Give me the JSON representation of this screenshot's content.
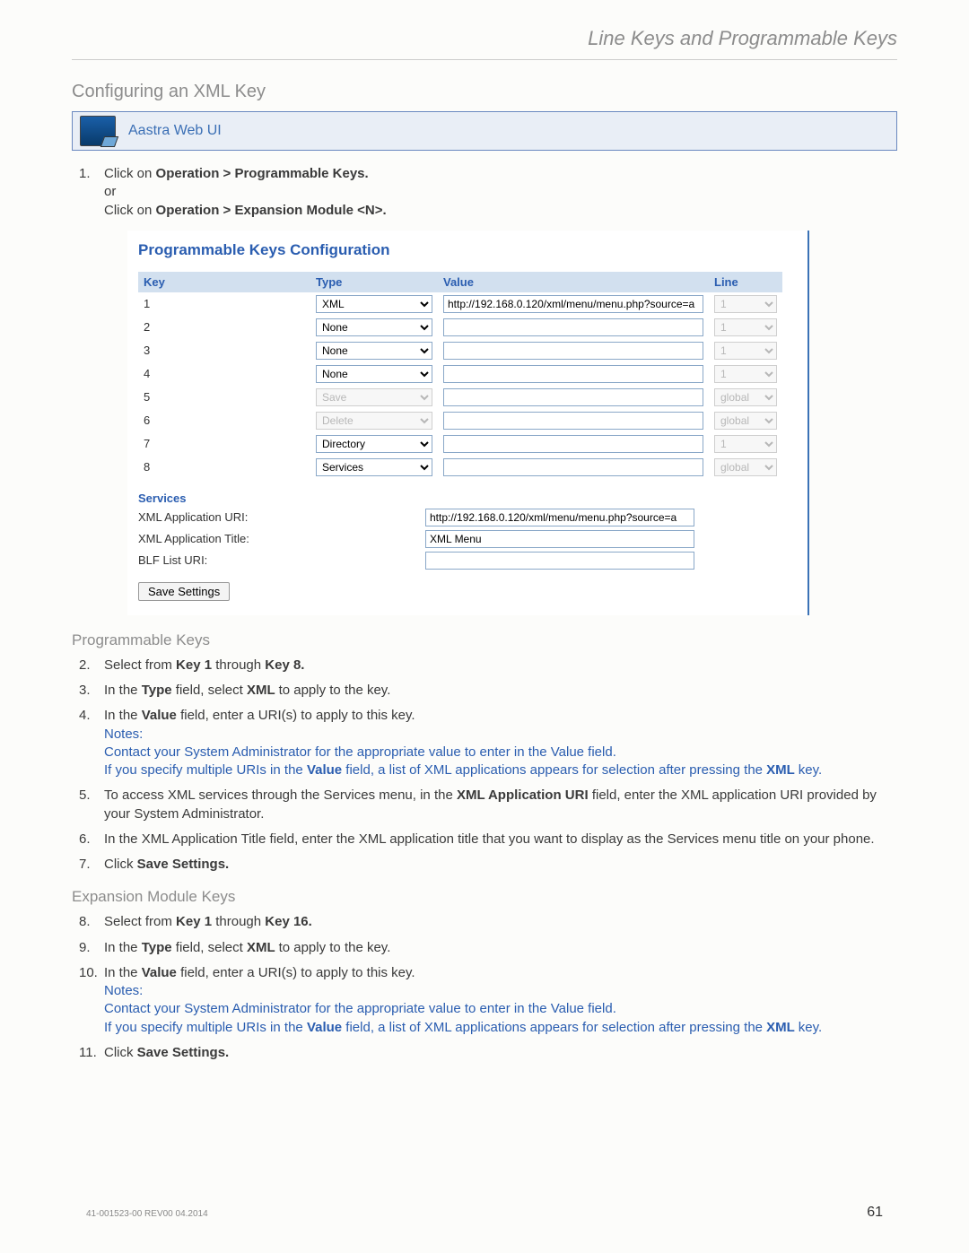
{
  "running_head": "Line Keys and Programmable Keys",
  "section_title": "Configuring an XML Key",
  "aastra_box_title": "Aastra Web UI",
  "step1": {
    "num": "1.",
    "a1": "Click on ",
    "a2": "Operation > Programmable Keys.",
    "or": "or",
    "b1": "Click on ",
    "b2": "Operation > Expansion Module <N>."
  },
  "ui": {
    "heading": "Programmable Keys Configuration",
    "headers": {
      "key": "Key",
      "type": "Type",
      "value": "Value",
      "line": "Line"
    },
    "rows": [
      {
        "key": "1",
        "type": "XML",
        "disabled": false,
        "value": "http://192.168.0.120/xml/menu/menu.php?source=a",
        "line": "1",
        "line_disabled": true
      },
      {
        "key": "2",
        "type": "None",
        "disabled": false,
        "value": "",
        "line": "1",
        "line_disabled": true
      },
      {
        "key": "3",
        "type": "None",
        "disabled": false,
        "value": "",
        "line": "1",
        "line_disabled": true
      },
      {
        "key": "4",
        "type": "None",
        "disabled": false,
        "value": "",
        "line": "1",
        "line_disabled": true
      },
      {
        "key": "5",
        "type": "Save",
        "disabled": true,
        "value": "",
        "line": "global",
        "line_disabled": true
      },
      {
        "key": "6",
        "type": "Delete",
        "disabled": true,
        "value": "",
        "line": "global",
        "line_disabled": true
      },
      {
        "key": "7",
        "type": "Directory",
        "disabled": false,
        "value": "",
        "line": "1",
        "line_disabled": true
      },
      {
        "key": "8",
        "type": "Services",
        "disabled": false,
        "value": "",
        "line": "global",
        "line_disabled": true
      }
    ],
    "services_title": "Services",
    "svc_uri_label": "XML Application URI:",
    "svc_uri_value": "http://192.168.0.120/xml/menu/menu.php?source=a",
    "svc_title_label": "XML Application Title:",
    "svc_title_value": "XML Menu",
    "blf_label": "BLF List URI:",
    "blf_value": "",
    "save_settings": "Save Settings"
  },
  "sub_prog": "Programmable Keys",
  "step2": {
    "num": "2.",
    "a": "Select from ",
    "b": "Key 1 ",
    "c": "through ",
    "d": "Key 8."
  },
  "step3": {
    "num": "3.",
    "a": "In the ",
    "b": "Type ",
    "c": "field, select ",
    "d": "XML ",
    "e": "to apply to the key."
  },
  "step4": {
    "num": "4.",
    "a": "In the ",
    "b": "Value ",
    "c": "field, enter a URI(s) to apply to this key.",
    "notes_label": "Notes:",
    "note1": "Contact your System Administrator for the appropriate value to enter in the Value field.",
    "note2a": "If you specify multiple URIs in the ",
    "note2b": "Value",
    "note2c": " field, a list of XML applications appears for selection after pressing the ",
    "note2d": "XML ",
    "note2e": "key."
  },
  "step5": {
    "num": "5.",
    "a": "To access XML services through the Services menu, in the ",
    "b": "XML Application URI ",
    "c": "field, enter the XML application URI provided by your System Administrator."
  },
  "step6": {
    "num": "6.",
    "a": "In the XML Application Title field, enter the XML application title that you want to display as the Services menu title on your phone."
  },
  "step7": {
    "num": "7.",
    "a": "Click ",
    "b": "Save Settings."
  },
  "sub_exp": "Expansion Module Keys",
  "step8": {
    "num": "8.",
    "a": " Select from ",
    "b": "Key 1",
    "c": " through ",
    "d": "Key 16."
  },
  "step9": {
    "num": "9.",
    "a": "In the ",
    "b": "Type ",
    "c": "field, select ",
    "d": "XML ",
    "e": "to apply to the key."
  },
  "step10": {
    "num": "10.",
    "a": "In the ",
    "b": "Value",
    "c": " field, enter a URI(s) to apply to this key.",
    "notes_label": "Notes:",
    "note1": "Contact your System Administrator for the appropriate value to enter in the Value field.",
    "note2a": "If you specify multiple URIs in the ",
    "note2b": "Value",
    "note2c": " field, a list of XML applications appears for selection after pressing the ",
    "note2d": "XML ",
    "note2e": "key."
  },
  "step11": {
    "num": "11.",
    "a": "Click ",
    "b": "Save Settings."
  },
  "footer_left": "41-001523-00 REV00  04.2014",
  "footer_right": "61"
}
